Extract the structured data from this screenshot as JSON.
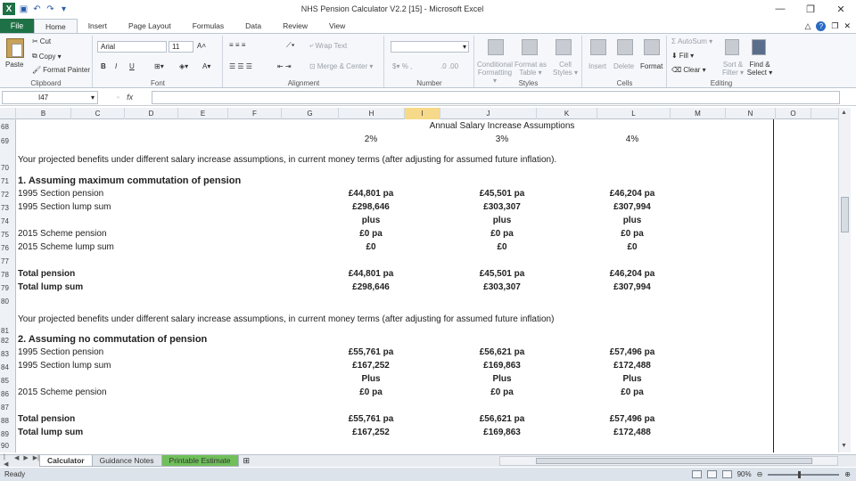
{
  "window": {
    "title": "NHS Pension Calculator V2.2 [15] - Microsoft Excel",
    "minimize": "—",
    "restore": "❐",
    "close": "✕"
  },
  "ribbon_tabs": [
    "File",
    "Home",
    "Insert",
    "Page Layout",
    "Formulas",
    "Data",
    "Review",
    "View"
  ],
  "active_tab": "Home",
  "ribbon": {
    "clipboard": {
      "paste": "Paste",
      "cut": "Cut",
      "copy": "Copy ▾",
      "format_painter": "Format Painter",
      "label": "Clipboard"
    },
    "font": {
      "name": "Arial",
      "size": "11",
      "bold": "B",
      "italic": "I",
      "underline": "U",
      "label": "Font"
    },
    "alignment": {
      "wrap_text": "Wrap Text",
      "merge_center": "Merge & Center ▾",
      "label": "Alignment"
    },
    "number": {
      "format": "",
      "label": "Number"
    },
    "styles": {
      "conditional": "Conditional Formatting ▾",
      "format_table": "Format as Table ▾",
      "cell_styles": "Cell Styles ▾",
      "label": "Styles"
    },
    "cells": {
      "insert": "Insert",
      "delete": "Delete",
      "format": "Format",
      "label": "Cells"
    },
    "editing": {
      "autosum": "AutoSum ▾",
      "fill": "Fill ▾",
      "clear": "Clear ▾",
      "sort_filter": "Sort & Filter ▾",
      "find_select": "Find & Select ▾",
      "label": "Editing"
    }
  },
  "formula_bar": {
    "name_box": "I47",
    "fx": "fx",
    "formula": ""
  },
  "columns": [
    "B",
    "C",
    "D",
    "E",
    "F",
    "G",
    "H",
    "I",
    "J",
    "K",
    "L",
    "M",
    "N",
    "O"
  ],
  "row_numbers": [
    "68",
    "69",
    "70",
    "71",
    "72",
    "73",
    "74",
    "75",
    "76",
    "77",
    "78",
    "79",
    "80",
    "81",
    "82",
    "83",
    "84",
    "85",
    "86",
    "87",
    "88",
    "89",
    "90"
  ],
  "sheet": {
    "header_title": "Annual Salary Increase Assumptions",
    "rates": [
      "2%",
      "3%",
      "4%"
    ],
    "intro1": "Your projected benefits under different salary increase assumptions, in current money terms (after adjusting for assumed future inflation).",
    "section1": {
      "title": "1. Assuming maximum commutation of pension",
      "rows": [
        {
          "label": "1995 Section pension",
          "values": [
            "£44,801 pa",
            "£45,501 pa",
            "£46,204 pa"
          ]
        },
        {
          "label": "1995 Section lump sum",
          "values": [
            "£298,646",
            "£303,307",
            "£307,994"
          ]
        },
        {
          "label": "",
          "values": [
            "plus",
            "plus",
            "plus"
          ]
        },
        {
          "label": "2015 Scheme pension",
          "values": [
            "£0 pa",
            "£0 pa",
            "£0 pa"
          ]
        },
        {
          "label": "2015 Scheme lump sum",
          "values": [
            "£0",
            "£0",
            "£0"
          ]
        }
      ],
      "total_pension": {
        "label": "Total pension",
        "values": [
          "£44,801 pa",
          "£45,501 pa",
          "£46,204 pa"
        ]
      },
      "total_lump": {
        "label": "Total lump sum",
        "values": [
          "£298,646",
          "£303,307",
          "£307,994"
        ]
      }
    },
    "intro2": "Your projected benefits under different salary increase assumptions, in current money terms (after adjusting for assumed future inflation)",
    "section2": {
      "title": "2. Assuming no commutation of pension",
      "rows": [
        {
          "label": "1995 Section pension",
          "values": [
            "£55,761 pa",
            "£56,621 pa",
            "£57,496 pa"
          ]
        },
        {
          "label": "1995 Section lump sum",
          "values": [
            "£167,252",
            "£169,863",
            "£172,488"
          ]
        },
        {
          "label": "",
          "values": [
            "Plus",
            "Plus",
            "Plus"
          ]
        },
        {
          "label": "2015 Scheme pension",
          "values": [
            "£0 pa",
            "£0 pa",
            "£0 pa"
          ]
        }
      ],
      "total_pension": {
        "label": "Total pension",
        "values": [
          "£55,761 pa",
          "£56,621 pa",
          "£57,496 pa"
        ]
      },
      "total_lump": {
        "label": "Total lump sum",
        "values": [
          "£167,252",
          "£169,863",
          "£172,488"
        ]
      }
    }
  },
  "sheet_tabs": [
    "Calculator",
    "Guidance Notes",
    "Printable Estimate"
  ],
  "active_sheet": "Calculator",
  "status": {
    "ready": "Ready",
    "zoom": "90%"
  },
  "colors": {
    "excel_green": "#1e7145",
    "selected_col": "#f7d98a",
    "tab_green": "#6fbf5a"
  }
}
